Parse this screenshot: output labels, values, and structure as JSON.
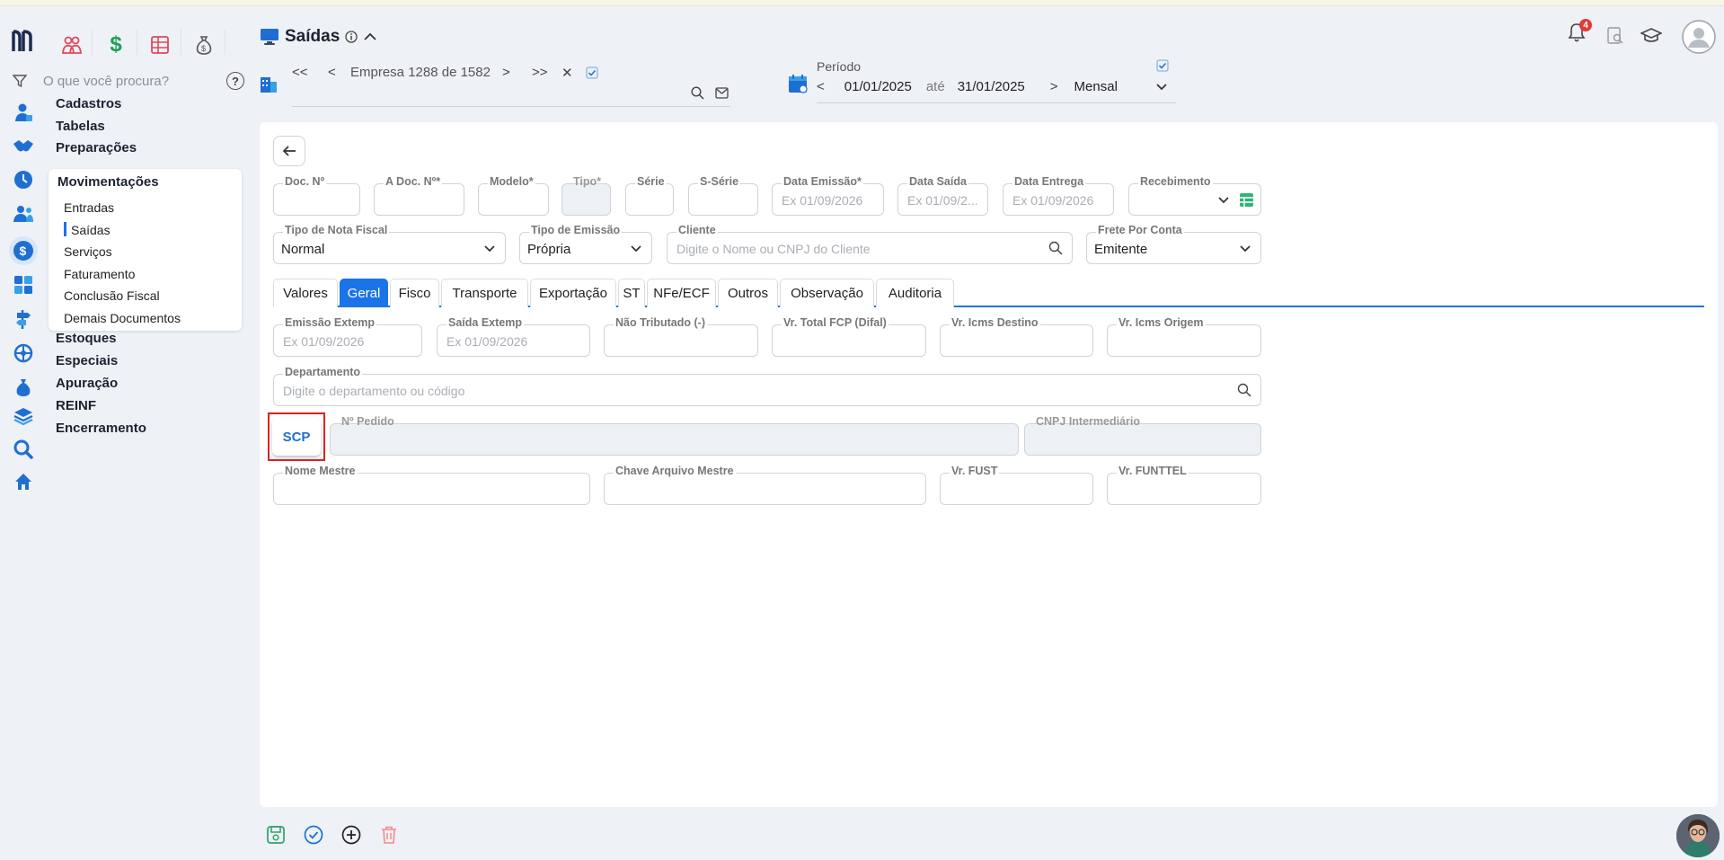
{
  "sidebar": {
    "search_placeholder": "O que você procura?",
    "help_label": "?",
    "menu_top": [
      "Cadastros",
      "Tabelas",
      "Preparações"
    ],
    "submenu": {
      "title": "Movimentações",
      "items": [
        "Entradas",
        "Saídas",
        "Serviços",
        "Faturamento",
        "Conclusão Fiscal",
        "Demais Documentos"
      ],
      "active_index": 1
    },
    "menu_bottom": [
      "Estoques",
      "Especiais",
      "Apuração",
      "REINF",
      "Encerramento"
    ]
  },
  "header": {
    "title": "Saídas",
    "company_nav": {
      "first": "<<",
      "prev": "<",
      "label": "Empresa 1288 de 1582",
      "next": ">",
      "last": ">>",
      "close": "✕"
    },
    "periodo": {
      "label": "Período",
      "from": "01/01/2025",
      "until": "até",
      "to": "31/01/2025",
      "mode": "Mensal"
    },
    "notifications_count": "4"
  },
  "form": {
    "row1": [
      {
        "label": "Doc. Nº",
        "placeholder": ""
      },
      {
        "label": "A Doc. Nº*",
        "placeholder": ""
      },
      {
        "label": "Modelo*",
        "placeholder": ""
      },
      {
        "label": "Tipo*",
        "placeholder": ""
      },
      {
        "label": "Série",
        "placeholder": ""
      },
      {
        "label": "S-Série",
        "placeholder": ""
      },
      {
        "label": "Data Emissão*",
        "placeholder": "Ex 01/09/2026"
      },
      {
        "label": "Data Saída",
        "placeholder": "Ex 01/09/2..."
      },
      {
        "label": "Data Entrega",
        "placeholder": "Ex 01/09/2026"
      },
      {
        "label": "Recebimento",
        "placeholder": ""
      }
    ],
    "row2": {
      "tipo_nota": {
        "label": "Tipo de Nota Fiscal",
        "value": "Normal"
      },
      "tipo_emissao": {
        "label": "Tipo de Emissão",
        "value": "Própria"
      },
      "cliente": {
        "label": "Cliente",
        "placeholder": "Digite o Nome ou CNPJ do Cliente"
      },
      "frete": {
        "label": "Frete Por Conta",
        "value": "Emitente"
      }
    },
    "tabs": [
      "Valores",
      "Geral",
      "Fisco",
      "Transporte",
      "Exportação",
      "ST",
      "NFe/ECF",
      "Outros",
      "Observação",
      "Auditoria"
    ],
    "active_tab": "Geral",
    "geral_row1": [
      {
        "label": "Emissão Extemp",
        "placeholder": "Ex 01/09/2026"
      },
      {
        "label": "Saída Extemp",
        "placeholder": "Ex 01/09/2026"
      },
      {
        "label": "Não Tributado (-)",
        "placeholder": ""
      },
      {
        "label": "Vr. Total FCP (Difal)",
        "placeholder": ""
      },
      {
        "label": "Vr. Icms Destino",
        "placeholder": ""
      },
      {
        "label": "Vr. Icms Origem",
        "placeholder": ""
      }
    ],
    "departamento": {
      "label": "Departamento",
      "placeholder": "Digite o departamento ou código"
    },
    "scp_button": "SCP",
    "pedido": {
      "label": "Nº Pedido"
    },
    "cnpj_intermediario": {
      "label": "CNPJ Intermediário"
    },
    "geral_row4": [
      {
        "label": "Nome Mestre"
      },
      {
        "label": "Chave Arquivo Mestre"
      },
      {
        "label": "Vr. FUST"
      },
      {
        "label": "Vr. FUNTTEL"
      }
    ]
  },
  "colors": {
    "accent": "#1a73e8",
    "highlight": "#e02020",
    "save": "#2fa36b",
    "delete": "#f08a8a"
  }
}
